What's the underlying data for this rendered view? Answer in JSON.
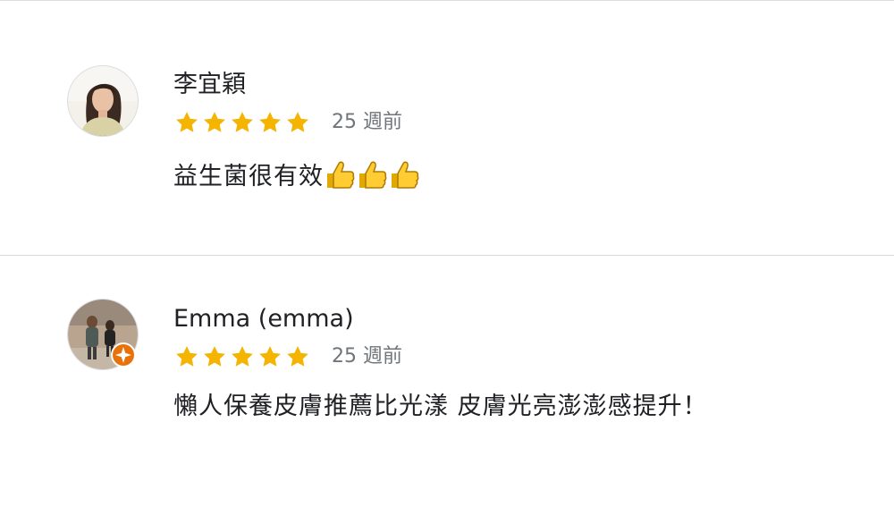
{
  "reviews": [
    {
      "reviewer_name": "李宜穎",
      "rating": 5,
      "stars_max": 5,
      "time_ago": "25 週前",
      "text": "益生菌很有效",
      "emoji": [
        "thumbs-up",
        "thumbs-up",
        "thumbs-up"
      ],
      "avatar_icon": "reviewer-photo",
      "local_guide": false
    },
    {
      "reviewer_name": "Emma (emma)",
      "rating": 5,
      "stars_max": 5,
      "time_ago": "25 週前",
      "text": "懶人保養皮膚推薦比光漾 皮膚光亮澎澎感提升！",
      "avatar_icon": "reviewer-photo",
      "local_guide": true,
      "badge_icon": "local-guide-badge-icon"
    }
  ],
  "colors": {
    "star": "#f4b400",
    "divider": "#dadce0",
    "secondary_text": "#70757a",
    "badge": "#e8710a"
  }
}
